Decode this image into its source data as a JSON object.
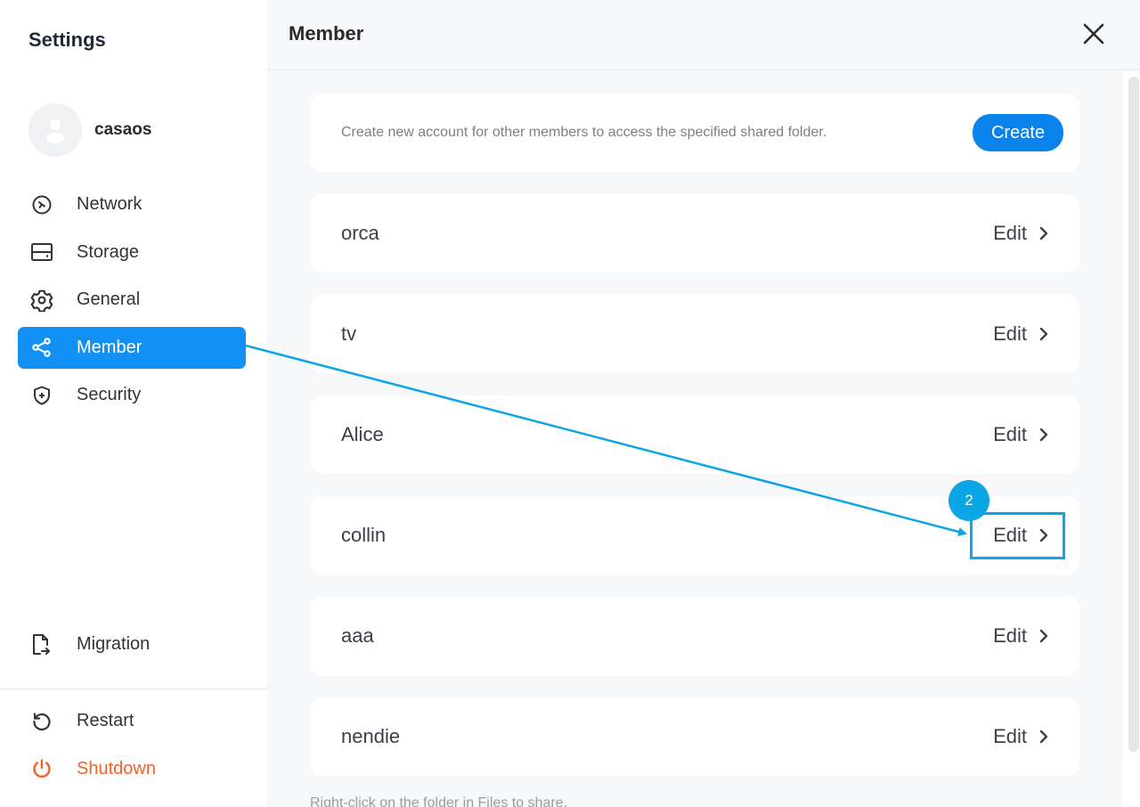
{
  "sidebar": {
    "title": "Settings",
    "user": {
      "name": "casaos",
      "avatar_icon": "user-avatar-icon"
    },
    "items": [
      {
        "id": "network",
        "label": "Network",
        "icon": "network-icon",
        "active": false
      },
      {
        "id": "storage",
        "label": "Storage",
        "icon": "storage-icon",
        "active": false
      },
      {
        "id": "general",
        "label": "General",
        "icon": "gear-icon",
        "active": false
      },
      {
        "id": "member",
        "label": "Member",
        "icon": "share-icon",
        "active": true
      },
      {
        "id": "security",
        "label": "Security",
        "icon": "shield-icon",
        "active": false
      }
    ],
    "migration": {
      "label": "Migration",
      "icon": "file-export-icon"
    },
    "restart": {
      "label": "Restart",
      "icon": "restart-icon"
    },
    "shutdown": {
      "label": "Shutdown",
      "icon": "power-icon",
      "color": "#f0622a"
    }
  },
  "main": {
    "title": "Member",
    "close_icon": "close-icon",
    "create_card": {
      "text": "Create new account for other members to access the specified shared folder.",
      "button_label": "Create"
    },
    "members": [
      {
        "name": "orca",
        "edit_label": "Edit"
      },
      {
        "name": "tv",
        "edit_label": "Edit"
      },
      {
        "name": "Alice",
        "edit_label": "Edit"
      },
      {
        "name": "collin",
        "edit_label": "Edit"
      },
      {
        "name": "aaa",
        "edit_label": "Edit"
      },
      {
        "name": "nendie",
        "edit_label": "Edit"
      }
    ],
    "footer_note": "Right-click on the folder in Files to share."
  },
  "annotation": {
    "step_number": "2",
    "target": "collin edit button",
    "color": "#0ba6e6"
  },
  "colors": {
    "accent": "#1390f3",
    "create_button": "#0a84ec",
    "danger": "#f0622a",
    "annotation": "#0ba6e6"
  }
}
